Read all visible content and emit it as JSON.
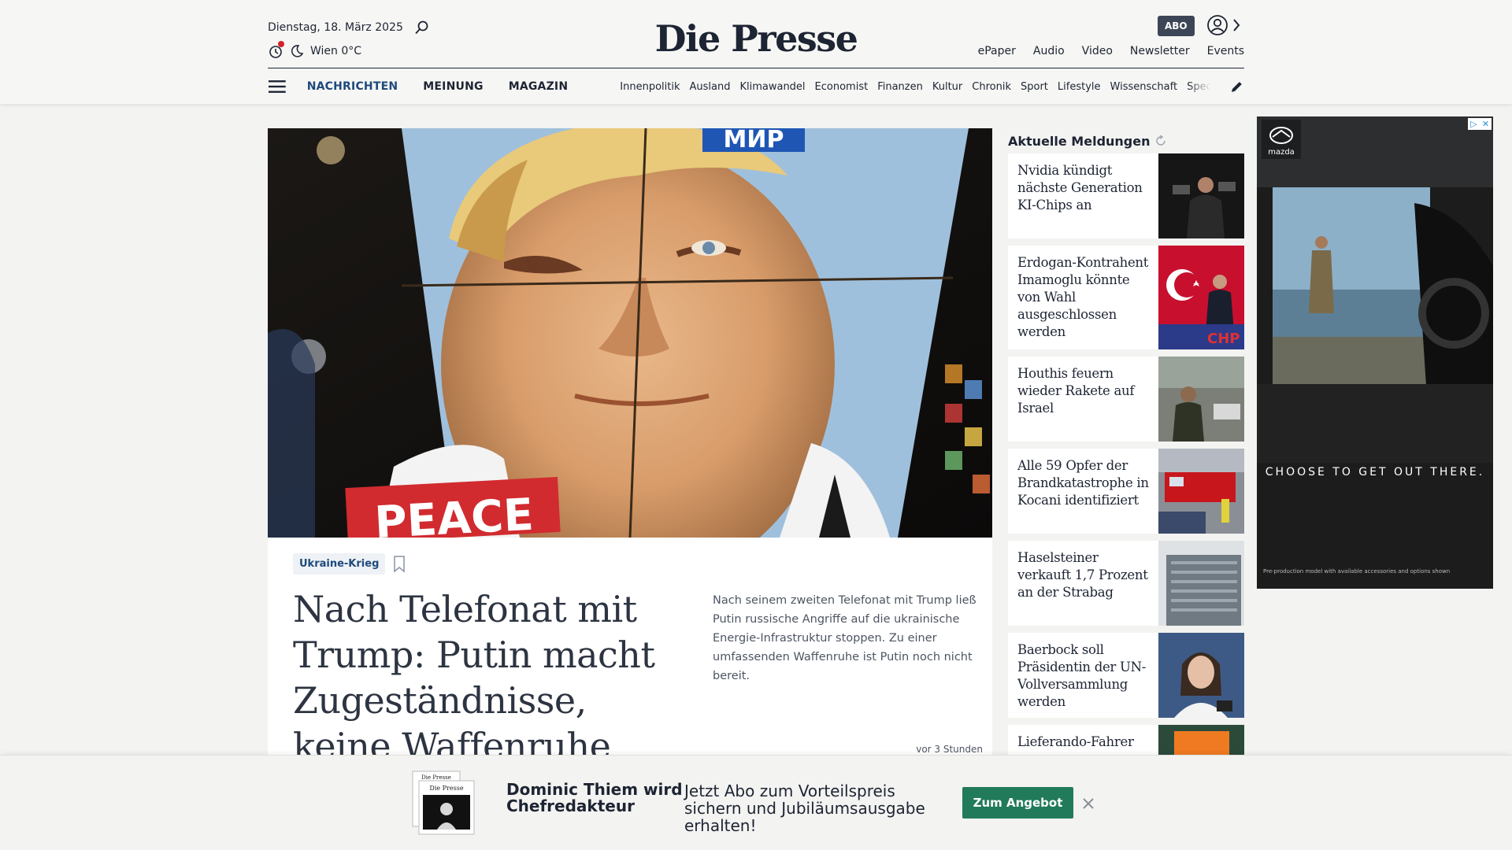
{
  "header": {
    "date": "Dienstag, 18. März 2025",
    "weather": "Wien 0°C",
    "logo": "Die Presse",
    "abo_label": "ABO",
    "top_links": [
      "ePaper",
      "Audio",
      "Video",
      "Newsletter",
      "Events"
    ],
    "main_nav": [
      "NACHRICHTEN",
      "MEINUNG",
      "MAGAZIN"
    ],
    "main_nav_active": "NACHRICHTEN",
    "sub_nav": [
      "Innenpolitik",
      "Ausland",
      "Klimawandel",
      "Economist",
      "Finanzen",
      "Kultur",
      "Chronik",
      "Sport",
      "Lifestyle",
      "Wissenschaft",
      "Spectrum"
    ]
  },
  "hero": {
    "image_sign_top": "МИР",
    "image_sign_bottom": "PEACE"
  },
  "article": {
    "tag": "Ukraine-Krieg",
    "headline": "Nach Telefonat mit Trump: Putin macht Zugeständnisse, keine Waffenruhe",
    "teaser": "Nach seinem zweiten Telefonat mit Trump ließ Putin russische Angriffe auf die ukrainische Energie-Infrastruktur stoppen. Zu einer umfassenden Waffenruhe ist Putin noch nicht bereit.",
    "timestamp": "vor 3 Stunden"
  },
  "sidebar": {
    "title": "Aktuelle Meldungen",
    "items": [
      {
        "title": "Nvidia kündigt nächste Generation KI-Chips an"
      },
      {
        "title": "Erdogan-Kontrahent Imamoglu könnte von Wahl ausgeschlossen werden"
      },
      {
        "title": "Houthis feuern wieder Rakete auf Israel"
      },
      {
        "title": "Alle 59 Opfer der Brandkatastrophe in Kocani identifiziert"
      },
      {
        "title": "Haselsteiner verkauft 1,7 Prozent an der Strabag"
      },
      {
        "title": "Baerbock soll Präsidentin der UN-Vollversammlung werden"
      },
      {
        "title": "Lieferando-Fahrer"
      }
    ]
  },
  "ad": {
    "brand": "mazda",
    "tagline": "CHOOSE TO GET OUT THERE.",
    "fine_print": "Pre-production model with available accessories and options shown"
  },
  "banner": {
    "title": "Dominic Thiem wird Chefredakteur",
    "offer": "Jetzt Abo zum Vorteilspreis sichern und Jubiläumsausgabe erhalten!",
    "cta": "Zum Angebot",
    "paper_label": "Die Presse"
  },
  "colors": {
    "brand_blue": "#1e4a7c",
    "text_dark": "#1d2433",
    "cta_green": "#217a5a",
    "alert_red": "#d3222a"
  },
  "icons": [
    "search-icon",
    "notification-icon",
    "moon-icon",
    "user-icon",
    "chevron-right-icon",
    "hamburger-icon",
    "pencil-icon",
    "bookmark-icon",
    "sync-icon",
    "close-icon"
  ]
}
